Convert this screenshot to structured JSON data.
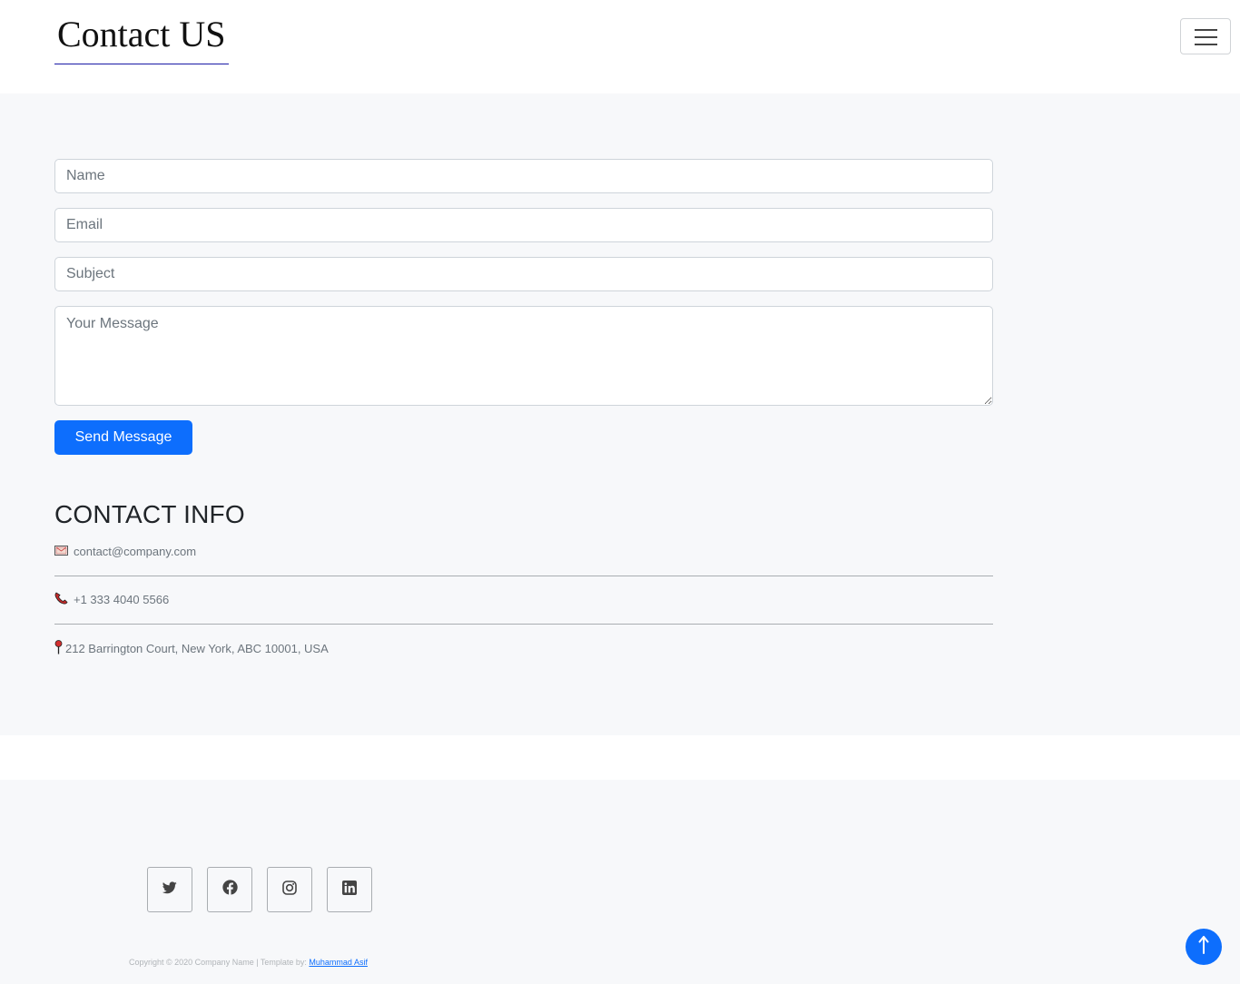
{
  "header": {
    "brand": "Contact US"
  },
  "form": {
    "name_placeholder": "Name",
    "email_placeholder": "Email",
    "subject_placeholder": "Subject",
    "message_placeholder": "Your Message",
    "send_label": "Send Message"
  },
  "contact_info": {
    "title": "CONTACT INFO",
    "email": "contact@company.com",
    "phone": "+1 333 4040 5566",
    "address": "212 Barrington Court, New York, ABC 10001, USA"
  },
  "footer": {
    "copyright_text": "Copyright © 2020 Company Name | Template by:",
    "author_link": "Muhammad Asif",
    "social": [
      "twitter-icon",
      "facebook-icon",
      "instagram-icon",
      "linkedin-icon"
    ]
  },
  "colors": {
    "primary": "#0d6efd",
    "background": "#f7f8fa",
    "brand_underline": "#1a1aa6"
  }
}
